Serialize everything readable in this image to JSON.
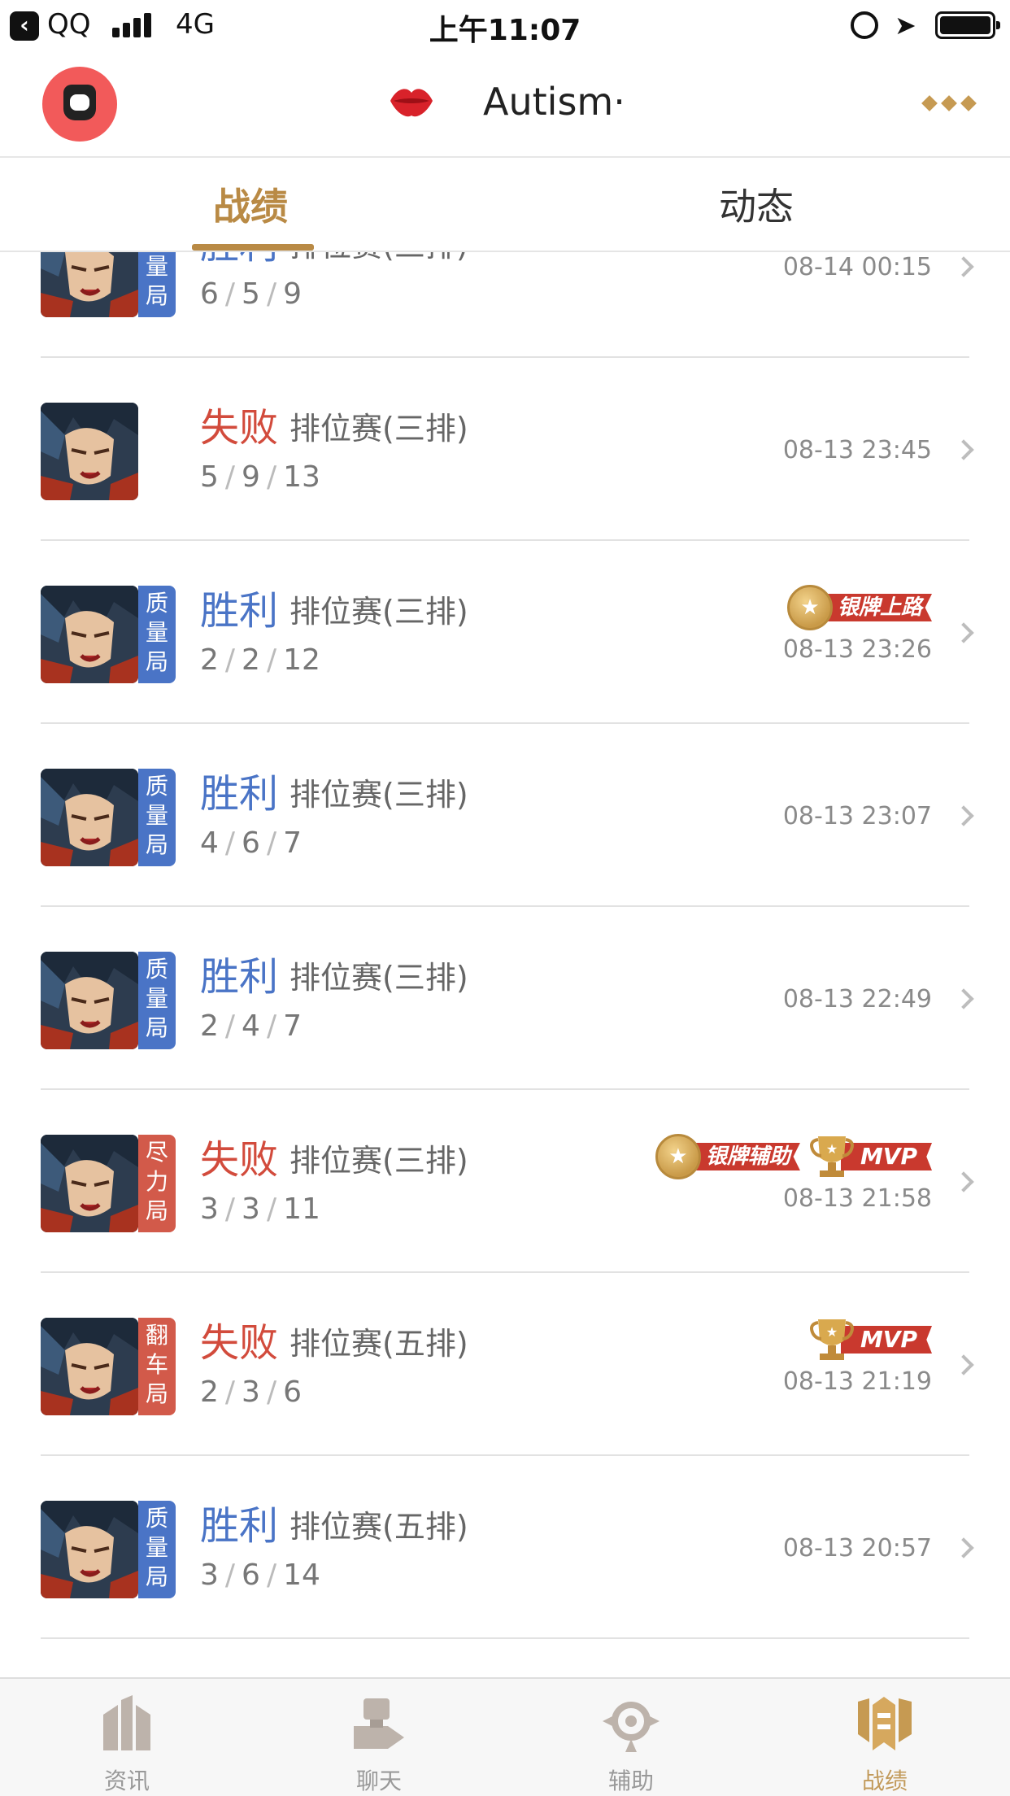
{
  "status_bar": {
    "back_app": "QQ",
    "network": "4G",
    "time": "上午11:07"
  },
  "top_nav": {
    "title": "Autism·",
    "avatar_icon": "avatar-icon",
    "badge_icon": "lips-icon",
    "more_icon": "more-dots-icon",
    "accent_color": "#c69a52"
  },
  "tabs": [
    {
      "label": "战绩",
      "active": true
    },
    {
      "label": "动态",
      "active": false
    }
  ],
  "matches": [
    {
      "result": "胜利",
      "mode": "排位赛(三排)",
      "kda": [
        "6",
        "5",
        "9"
      ],
      "tag": "质量局",
      "tag_color": "blue",
      "time": "08-14 00:15",
      "badges": []
    },
    {
      "result": "失败",
      "mode": "排位赛(三排)",
      "kda": [
        "5",
        "9",
        "13"
      ],
      "tag": "",
      "tag_color": "",
      "time": "08-13 23:45",
      "badges": []
    },
    {
      "result": "胜利",
      "mode": "排位赛(三排)",
      "kda": [
        "2",
        "2",
        "12"
      ],
      "tag": "质量局",
      "tag_color": "blue",
      "time": "08-13 23:26",
      "badges": [
        "银牌上路"
      ]
    },
    {
      "result": "胜利",
      "mode": "排位赛(三排)",
      "kda": [
        "4",
        "6",
        "7"
      ],
      "tag": "质量局",
      "tag_color": "blue",
      "time": "08-13 23:07",
      "badges": []
    },
    {
      "result": "胜利",
      "mode": "排位赛(三排)",
      "kda": [
        "2",
        "4",
        "7"
      ],
      "tag": "质量局",
      "tag_color": "blue",
      "time": "08-13 22:49",
      "badges": []
    },
    {
      "result": "失败",
      "mode": "排位赛(三排)",
      "kda": [
        "3",
        "3",
        "11"
      ],
      "tag": "尽力局",
      "tag_color": "red",
      "time": "08-13 21:58",
      "badges": [
        "银牌辅助",
        "MVP"
      ]
    },
    {
      "result": "失败",
      "mode": "排位赛(五排)",
      "kda": [
        "2",
        "3",
        "6"
      ],
      "tag": "翻车局",
      "tag_color": "red",
      "time": "08-13 21:19",
      "badges": [
        "MVP"
      ]
    },
    {
      "result": "胜利",
      "mode": "排位赛(五排)",
      "kda": [
        "3",
        "6",
        "14"
      ],
      "tag": "质量局",
      "tag_color": "blue",
      "time": "08-13 20:57",
      "badges": []
    }
  ],
  "bottom_tabs": [
    {
      "label": "资讯",
      "icon": "news-icon",
      "active": false
    },
    {
      "label": "聊天",
      "icon": "chat-icon",
      "active": false
    },
    {
      "label": "辅助",
      "icon": "assist-icon",
      "active": false
    },
    {
      "label": "战绩",
      "icon": "record-icon",
      "active": true
    }
  ],
  "colors": {
    "win": "#4a74c6",
    "lose": "#d24b3c",
    "accent": "#b98a45",
    "badge_ribbon": "#c9392e"
  }
}
